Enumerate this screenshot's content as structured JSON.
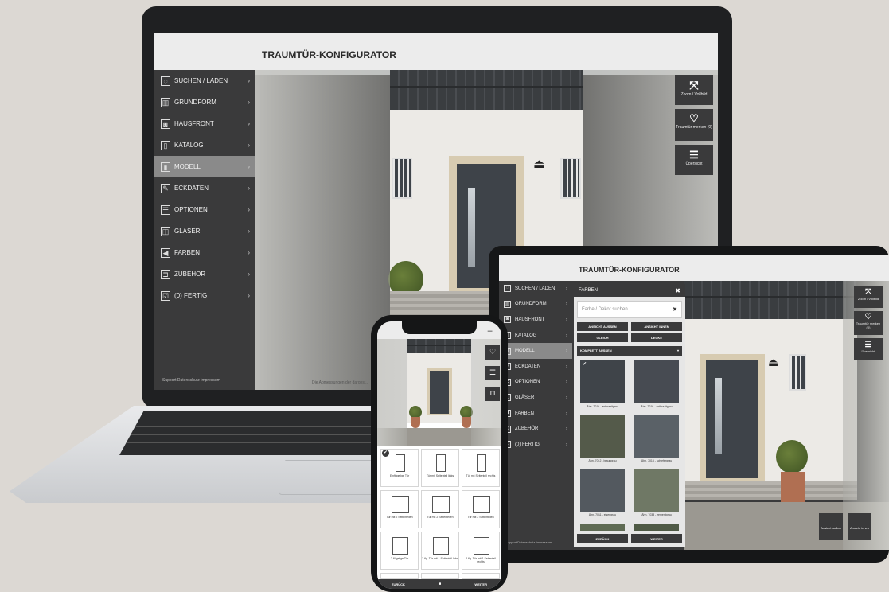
{
  "app": {
    "title": "TRAUMTÜR-KONFIGURATOR"
  },
  "sidebar": {
    "items": [
      {
        "label": "SUCHEN / LADEN",
        "icon": "dashed-circle-icon"
      },
      {
        "label": "GRUNDFORM",
        "icon": "door-grid-icon"
      },
      {
        "label": "HAUSFRONT",
        "icon": "camera-icon"
      },
      {
        "label": "KATALOG",
        "icon": "book-icon"
      },
      {
        "label": "MODELL",
        "icon": "model-door-icon",
        "active": true
      },
      {
        "label": "ECKDATEN",
        "icon": "pencil-icon"
      },
      {
        "label": "OPTIONEN",
        "icon": "sliders-icon"
      },
      {
        "label": "GLÄSER",
        "icon": "glass-icon"
      },
      {
        "label": "FARBEN",
        "icon": "color-tag-icon"
      },
      {
        "label": "ZUBEHÖR",
        "icon": "handle-icon"
      },
      {
        "label": "(0) FERTIG",
        "icon": "checkbox-icon"
      }
    ],
    "footer": {
      "support": "Support",
      "privacy": "Datenschutz",
      "imprint": "Impressum"
    },
    "disclaimer": "Die Abmessungen der dargest..."
  },
  "tools": {
    "zoom": "Zoom / Vollbild",
    "favorite": "Traumtür merken (0)",
    "overview": "Übersicht"
  },
  "tablet": {
    "panel_title": "FARBEN",
    "search_placeholder": "Farbe / Dekor suchen",
    "tabs": [
      "ANSICHT AUSSEN",
      "ANSICHT INNEN",
      "GLEICH",
      "DECKE"
    ],
    "dropdown": "KOMPLETT AUSSEN",
    "swatches": [
      {
        "label": "Ähn. 7016 - anthrazitgrau",
        "color": "#3f4449",
        "selected": true
      },
      {
        "label": "Ähn. 7016 - anthrazitgrau",
        "color": "#474b52"
      },
      {
        "label": "Ähn. 7012 - braungrau",
        "color": "#545a4a"
      },
      {
        "label": "Ähn. 7015 - schiefergrau",
        "color": "#5a6167"
      },
      {
        "label": "Ähn. 7011 - eisengrau",
        "color": "#53595f"
      },
      {
        "label": "Ähn. 7033 - zementgrau",
        "color": "#6f7865"
      }
    ],
    "back": "ZURÜCK",
    "next": "WEITER",
    "view_outside": "Ansicht außen",
    "view_inside": "Ansicht innen"
  },
  "phone": {
    "models": [
      "Einflügelige Tür",
      "Tür mit Seitenteil links",
      "Tür mit Seitenteil rechts",
      "Tür mit 2 Seitenteilen",
      "Tür mit 2 Seitenteilen",
      "Tür mit 2 Seitenteilen",
      "2-flügelige Tür",
      "2-flg. Tür mit 1 Seitenteil links",
      "2-flg. Tür mit 1 Seitenteil rechts"
    ],
    "back": "ZURÜCK",
    "next": "WEITER"
  },
  "colors": {
    "sidebar": "#3a3a3b",
    "active": "#8a8a8a",
    "header": "#ececec",
    "background": "#dcd8d3"
  }
}
